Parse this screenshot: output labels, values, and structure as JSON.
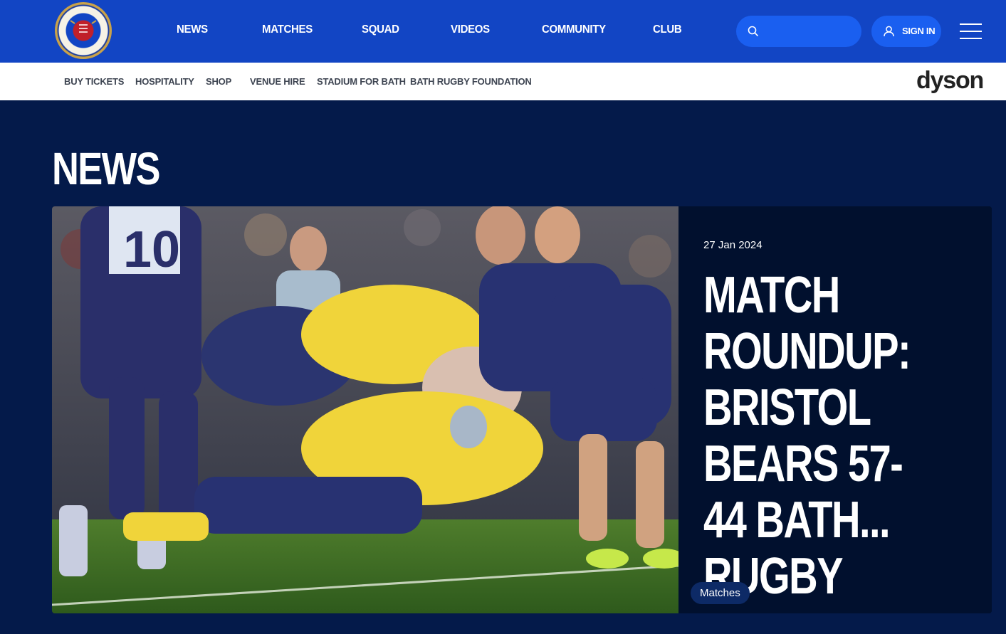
{
  "brand": {
    "logo_alt": "Bath Rugby",
    "colors": {
      "primary": "#1245c4",
      "navy": "#041a4a",
      "card": "#01102e",
      "pill": "#1a5ff0"
    }
  },
  "main_nav": {
    "items": [
      {
        "label": "NEWS"
      },
      {
        "label": "MATCHES"
      },
      {
        "label": "SQUAD"
      },
      {
        "label": "VIDEOS"
      },
      {
        "label": "COMMUNITY"
      },
      {
        "label": "CLUB"
      }
    ],
    "search": {
      "icon": "search-icon",
      "placeholder": ""
    },
    "sign_in_label": "SIGN IN",
    "menu_icon": "hamburger-menu-icon"
  },
  "sub_nav": {
    "items": [
      {
        "label": "BUY TICKETS"
      },
      {
        "label": "HOSPITALITY"
      },
      {
        "label": "SHOP"
      },
      {
        "label": "VENUE HIRE"
      },
      {
        "label": "STADIUM FOR BATH"
      },
      {
        "label": "BATH RUGBY FOUNDATION"
      }
    ],
    "sponsor": "dyson"
  },
  "page": {
    "title": "NEWS"
  },
  "featured": {
    "date": "27 Jan 2024",
    "title": "MATCH ROUNDUP: BRISTOL BEARS 57-44 BATH... RUGBY",
    "tag": "Matches",
    "image_alt": "Rugby players in a ruck as a Bath player dives for the try line"
  }
}
